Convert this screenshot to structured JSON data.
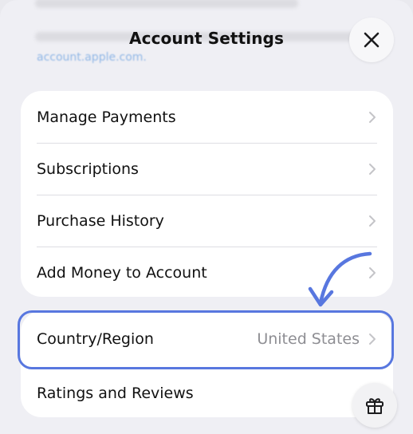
{
  "header": {
    "title": "Account Settings",
    "background_link": "account.apple.com."
  },
  "groups": [
    {
      "items": [
        {
          "label": "Manage Payments"
        },
        {
          "label": "Subscriptions"
        },
        {
          "label": "Purchase History"
        },
        {
          "label": "Add Money to Account"
        }
      ]
    },
    {
      "items": [
        {
          "label": "Country/Region",
          "value": "United States"
        },
        {
          "label": "Ratings and Reviews"
        }
      ]
    }
  ],
  "icons": {
    "close": "close-icon",
    "chevron": "chevron-right-icon",
    "gift": "gift-icon",
    "annotation": "curved-arrow-icon"
  },
  "colors": {
    "highlight": "#5877df",
    "chevron": "#c4c4c8",
    "value_text": "#8e8e93"
  }
}
